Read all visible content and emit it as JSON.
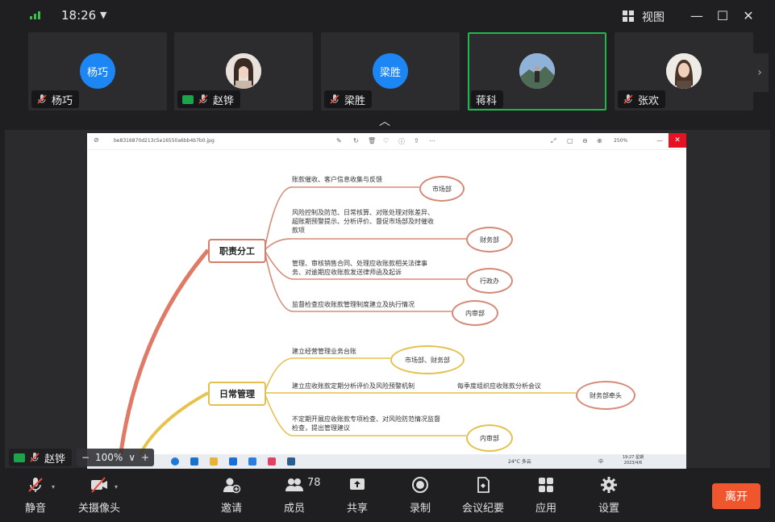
{
  "topbar": {
    "time": "18:26",
    "view_label": "视图"
  },
  "participants": [
    {
      "name": "杨巧",
      "avatar_text": "杨巧",
      "avatar_type": "text",
      "muted": true,
      "sharing": false,
      "active": false
    },
    {
      "name": "赵铧",
      "avatar_text": "",
      "avatar_type": "photo",
      "muted": true,
      "sharing": true,
      "active": false
    },
    {
      "name": "梁胜",
      "avatar_text": "梁胜",
      "avatar_type": "text",
      "muted": true,
      "sharing": false,
      "active": false
    },
    {
      "name": "蒋科",
      "avatar_text": "",
      "avatar_type": "photo",
      "muted": false,
      "sharing": false,
      "active": true
    },
    {
      "name": "张欢",
      "avatar_text": "",
      "avatar_type": "photo",
      "muted": true,
      "sharing": false,
      "active": false
    }
  ],
  "share": {
    "viewer_filename": "be8316870d213c5e16550a6bb4b7b0.jpg",
    "viewer_zoom": "250%",
    "mindmap": {
      "main1": "职责分工",
      "main2": "日常管理",
      "b1_text": "账款催收、客户信息收集与反馈",
      "b1_node": "市场部",
      "b2_text": "风险控制及防范、日常核算、对账处理对账差异、超账期预警提示、分析评价、督促市场部及时催收款项",
      "b2_node": "财务部",
      "b3_text": "管理、审核销售合同、处理应收账款相关法律事务、对逾期应收账款发送律师函及起诉",
      "b3_node": "行政办",
      "b4_text": "监督检查应收账款管理制度建立及执行情况",
      "b4_node": "内审部",
      "c1_text": "建立经营管理业务台账",
      "c1_node": "市场部、财务部",
      "c2_text": "建立应收账款定期分析评价及风险预警机制",
      "c2_extra": "每季度组织应收账款分析会议",
      "c2_node": "财务部牵头",
      "c3_text": "不定期开展应收账款专项检查、对风险防范情况监督检查，提出管理建议",
      "c3_node": "内审部"
    },
    "taskbar": {
      "weather": "24°C 多云",
      "ime": "中",
      "time": "19:27 星期",
      "date": "2023/4/6"
    }
  },
  "presenter": {
    "name": "赵铧"
  },
  "zoom": {
    "minus": "−",
    "value": "100%",
    "caret": "∨",
    "plus": "+"
  },
  "toolbar": {
    "mute": "静音",
    "camera": "关摄像头",
    "invite": "邀请",
    "members": "成员",
    "members_count": "78",
    "share": "共享",
    "record": "录制",
    "minutes": "会议纪要",
    "apps": "应用",
    "settings": "设置",
    "leave": "离开"
  },
  "colors": {
    "accent_green": "#1fb84c",
    "avatar_blue": "#1d86f5",
    "leave": "#f0562e",
    "branch_red": "#d47e6c",
    "branch_yellow": "#e4c04e"
  }
}
